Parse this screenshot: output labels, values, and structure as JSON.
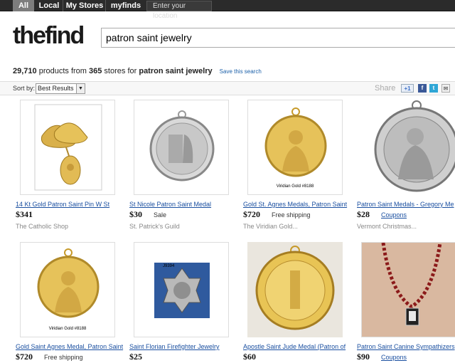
{
  "nav": {
    "tabs": [
      "All",
      "Local",
      "My Stores",
      "myfinds"
    ],
    "location_placeholder": "Enter your location"
  },
  "header": {
    "logo_the": "the",
    "logo_find": "find",
    "search_value": "patron saint jewelry"
  },
  "results": {
    "count": "29,710",
    "text_mid": " products from ",
    "stores": "365",
    "text_for": " stores for ",
    "query": "patron saint jewelry",
    "save_link": "Save this search"
  },
  "sortbar": {
    "label": "Sort by:",
    "selected": "Best Results",
    "share": "Share",
    "plus1": "+1",
    "fb": "f",
    "tw": "t",
    "mail": "✉"
  },
  "products": [
    {
      "title": "14 Kt Gold Patron Saint Pin W St",
      "price": "$341",
      "extra": "",
      "store": "The Catholic Shop"
    },
    {
      "title": "St Nicole Patron Saint Medal",
      "price": "$30",
      "extra": "Sale",
      "store": "St. Patrick's Guild"
    },
    {
      "title": "Gold St. Agnes Medals, Patron Saint",
      "price": "$720",
      "extra": "Free shipping",
      "store": "The Viridian Gold...",
      "caption": "Viridian Gold #8188"
    },
    {
      "title": "Patron Saint Medals - Gregory Me",
      "price": "$28",
      "extra": "Coupons",
      "store": "Vermont Christmas..."
    },
    {
      "title": "Gold Saint Agnes Medal, Patron Saint",
      "price": "$720",
      "extra": "Free shipping",
      "store": "",
      "caption": "Viridian Gold #8188"
    },
    {
      "title": "Saint Florian Firefighter Jewelry",
      "price": "$25",
      "extra": "",
      "store": "",
      "caption": "J9394"
    },
    {
      "title": "Apostle Saint Jude Medal (Patron of",
      "price": "$60",
      "extra": "",
      "store": ""
    },
    {
      "title": "Patron Saint Canine Sympathizers",
      "price": "$90",
      "extra": "Coupons",
      "store": ""
    }
  ]
}
